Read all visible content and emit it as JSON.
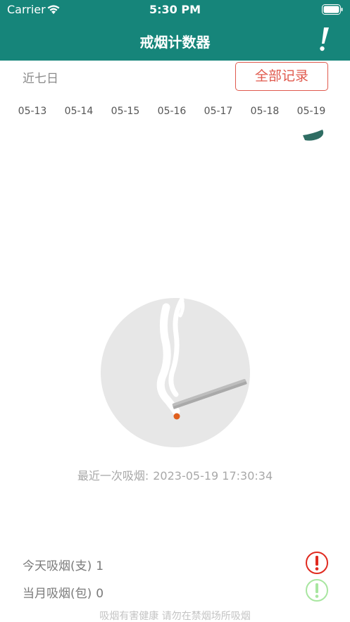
{
  "status_bar": {
    "carrier": "Carrier",
    "time": "5:30 PM"
  },
  "header": {
    "title": "戒烟计数器",
    "info_icon": "exclamation-icon"
  },
  "range": {
    "label": "近七日",
    "all_records_label": "全部记录"
  },
  "dates": [
    "05-13",
    "05-14",
    "05-15",
    "05-16",
    "05-17",
    "05-18",
    "05-19"
  ],
  "illustration": {
    "icon": "smoking-cigarette-icon"
  },
  "last_smoke": {
    "label": "最近一次吸烟:",
    "value": "2023-05-19 17:30:34"
  },
  "stats": {
    "today_label": "今天吸烟(支)",
    "today_value": "1",
    "month_label": "当月吸烟(包)",
    "month_value": "0"
  },
  "footer": {
    "note": "吸烟有害健康 请勿在禁烟场所吸烟"
  },
  "colors": {
    "brand": "#16857a",
    "accent_red": "#e05a4e",
    "alert_red": "#e02a1f",
    "alert_green": "#a8e6a0"
  }
}
